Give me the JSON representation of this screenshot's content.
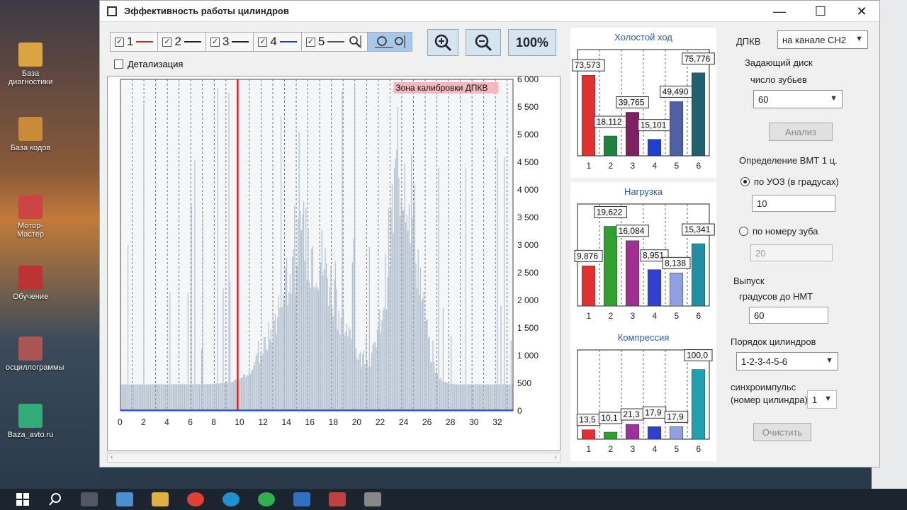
{
  "window": {
    "title": "Эффективность работы цилиндров"
  },
  "desktop_icons": [
    {
      "label": "База диагностики",
      "color": "#d9a441"
    },
    {
      "label": "База кодов",
      "color": "#c98a3a"
    },
    {
      "label": "Мотор-Мастер",
      "color": "#c44"
    },
    {
      "label": "Обучение",
      "color": "#b33"
    },
    {
      "label": "осциллограммы",
      "color": "#a55"
    },
    {
      "label": "Baza_avto.ru",
      "color": "#3a7"
    }
  ],
  "toolbar": {
    "channels": [
      {
        "label": "1",
        "color": "#d02020",
        "checked": true
      },
      {
        "label": "2",
        "color": "#222222",
        "checked": true
      },
      {
        "label": "3",
        "color": "#222222",
        "checked": true
      },
      {
        "label": "4",
        "color": "#2040d0",
        "checked": true
      },
      {
        "label": "5",
        "color": "#555555",
        "checked": true
      }
    ],
    "zoom_100_label": "100%",
    "detail_label": "Детализация"
  },
  "main_chart": {
    "calibration_label": "Зона калибровки ДПКВ",
    "y_ticks": [
      "6 000",
      "5 500",
      "5 000",
      "4 500",
      "4 000",
      "3 500",
      "3 000",
      "2 500",
      "2 000",
      "1 500",
      "1 000",
      "500",
      "0"
    ],
    "x_ticks": [
      "0",
      "2",
      "4",
      "6",
      "8",
      "10",
      "12",
      "14",
      "16",
      "18",
      "20",
      "22",
      "24",
      "26",
      "28",
      "30",
      "32"
    ]
  },
  "chart_data": [
    {
      "type": "bar",
      "title": "Холостой ход",
      "categories": [
        "1",
        "2",
        "3",
        "4",
        "5",
        "6"
      ],
      "values": [
        73.573,
        18.112,
        39.765,
        15.101,
        49.49,
        75.776
      ],
      "labels": [
        "73,573",
        "18,112",
        "39,765",
        "15,101",
        "49,490",
        "75,776"
      ],
      "colors": [
        "#e03030",
        "#208040",
        "#802060",
        "#2040d0",
        "#5060a0",
        "#206070"
      ]
    },
    {
      "type": "bar",
      "title": "Нагрузка",
      "categories": [
        "1",
        "2",
        "3",
        "4",
        "5",
        "6"
      ],
      "values": [
        9.876,
        19.622,
        16.084,
        8.951,
        8.138,
        15.341
      ],
      "labels": [
        "9,876",
        "19,622",
        "16,084",
        "8,951",
        "8,138",
        "15,341"
      ],
      "colors": [
        "#e03030",
        "#30a030",
        "#a03090",
        "#3040d0",
        "#90a0e0",
        "#2090a0"
      ]
    },
    {
      "type": "bar",
      "title": "Компрессия",
      "categories": [
        "1",
        "2",
        "3",
        "4",
        "5",
        "6"
      ],
      "values": [
        13.5,
        10.1,
        21.3,
        17.9,
        17.9,
        100.0
      ],
      "labels": [
        "13,5",
        "10,1",
        "21,3",
        "17,9",
        "17,9",
        "100,0"
      ],
      "colors": [
        "#e03030",
        "#30a030",
        "#a030a0",
        "#3040d0",
        "#90a0e0",
        "#20a0b0"
      ]
    }
  ],
  "settings": {
    "dpkv_label": "ДПКВ",
    "dpkv_value": "на канале CH2",
    "disk_label1": "Задающий диск",
    "disk_label2": "число зубьев",
    "teeth_value": "60",
    "analyze_label": "Анализ",
    "tdc_label": "Определение ВМТ 1 ц.",
    "by_uoz_label": "по УОЗ (в градусах)",
    "uoz_value": "10",
    "by_tooth_label": "по номеру зуба",
    "tooth_value": "20",
    "exhaust_label": "Выпуск",
    "degrees_label": "градусов до НМТ",
    "degrees_value": "60",
    "order_label": "Порядок цилиндров",
    "order_value": "1-2-3-4-5-6",
    "sync_label1": "синхроимпульс",
    "sync_label2": "(номер цилиндра)",
    "sync_value": "1",
    "clear_label": "Очистить"
  }
}
